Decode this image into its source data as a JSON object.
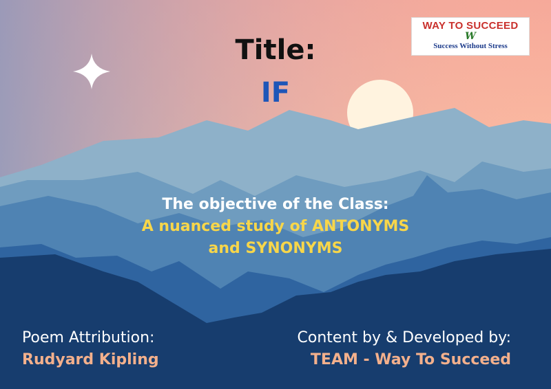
{
  "slide": {
    "title_label": "Title:",
    "title_value": "IF",
    "objective_heading": "The objective of the Class:",
    "objective_line_1": "A nuanced study of ANTONYMS",
    "objective_line_2": "and SYNONYMS",
    "attribution_label": "Poem Attribution:",
    "attribution_value": "Rudyard Kipling",
    "developer_label": "Content by & Developed by:",
    "developer_value": "TEAM - Way To Succeed"
  },
  "logo": {
    "brand": "WAY TO SUCCEED",
    "mark": "W",
    "tagline": "Success Without Stress"
  },
  "colors": {
    "title_value": "#1e56b8",
    "objective_highlight": "#f7d64a",
    "name_highlight": "#f3b08c",
    "sky_top": "#7f93b8",
    "sky_bottom": "#fbb9a0",
    "mountain_dark": "#173d6e"
  },
  "icons": [
    "sparkle-star-icon",
    "sun-icon"
  ]
}
